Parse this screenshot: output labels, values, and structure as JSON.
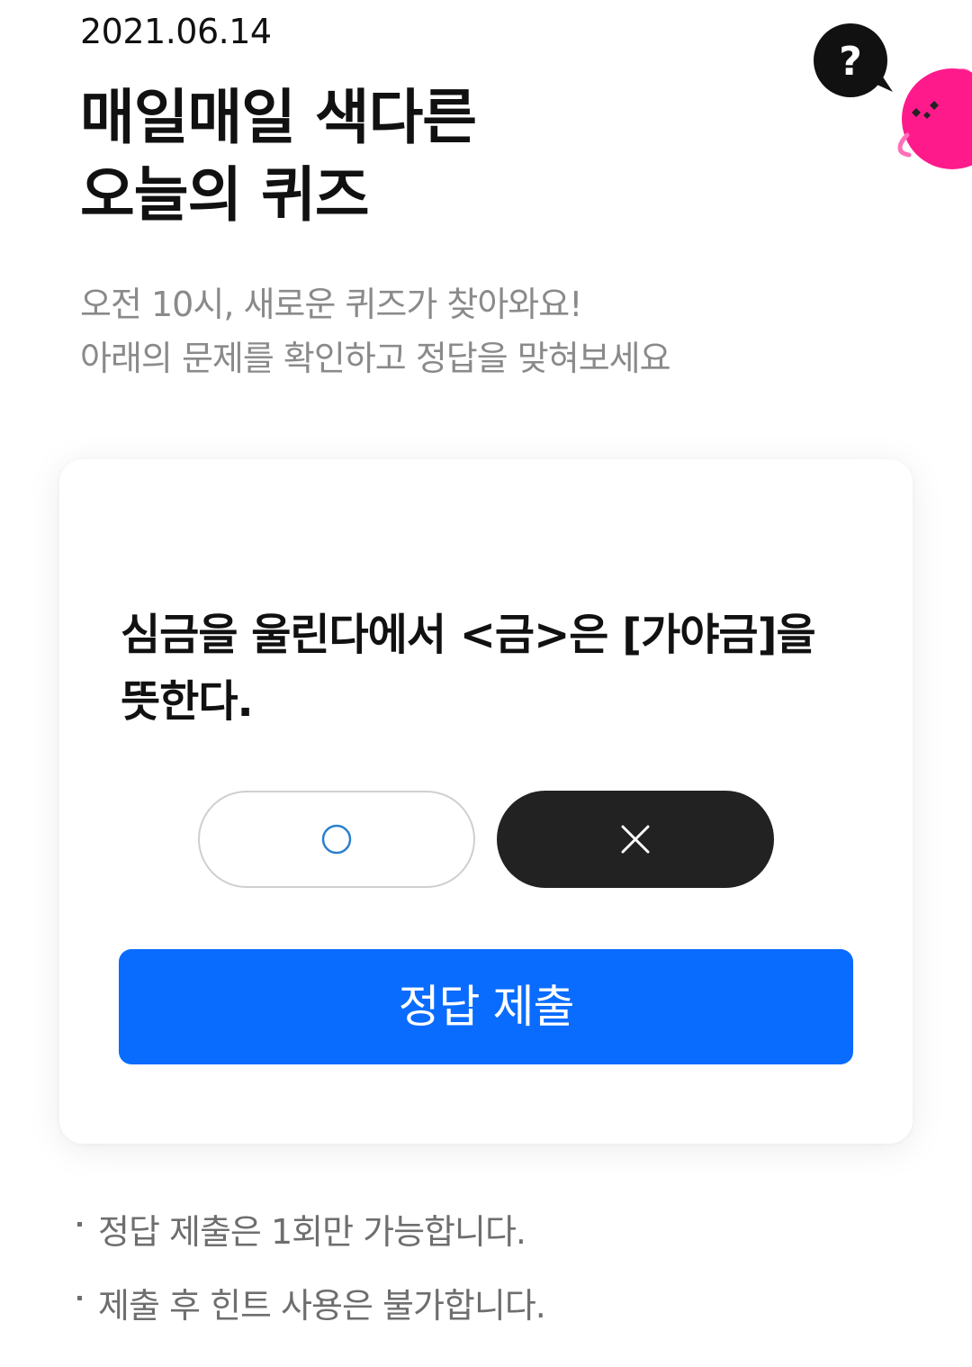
{
  "header": {
    "date": "2021.06.14",
    "title_line1": "매일매일 색다른",
    "title_line2": "오늘의 퀴즈",
    "subtitle_line1": "오전 10시, 새로운 퀴즈가 찾아와요!",
    "subtitle_line2": "아래의 문제를 확인하고 정답을 맞혀보세요",
    "help_icon_glyph": "?"
  },
  "quiz": {
    "question": "심금을 울린다에서 <금>은 [가야금]을 뜻한다.",
    "options": [
      {
        "name": "O",
        "icon": "circle-o-icon",
        "selected": false
      },
      {
        "name": "X",
        "icon": "x-icon",
        "selected": true
      }
    ],
    "submit_label": "정답 제출"
  },
  "notes": [
    "정답 제출은 1회만 가능합니다.",
    "제출 후 힌트 사용은 불가합니다."
  ],
  "colors": {
    "accent": "#0a6cff",
    "selected_choice": "#222222",
    "mascot": "#ff1a8c",
    "circle_icon": "#2b7fcf"
  }
}
